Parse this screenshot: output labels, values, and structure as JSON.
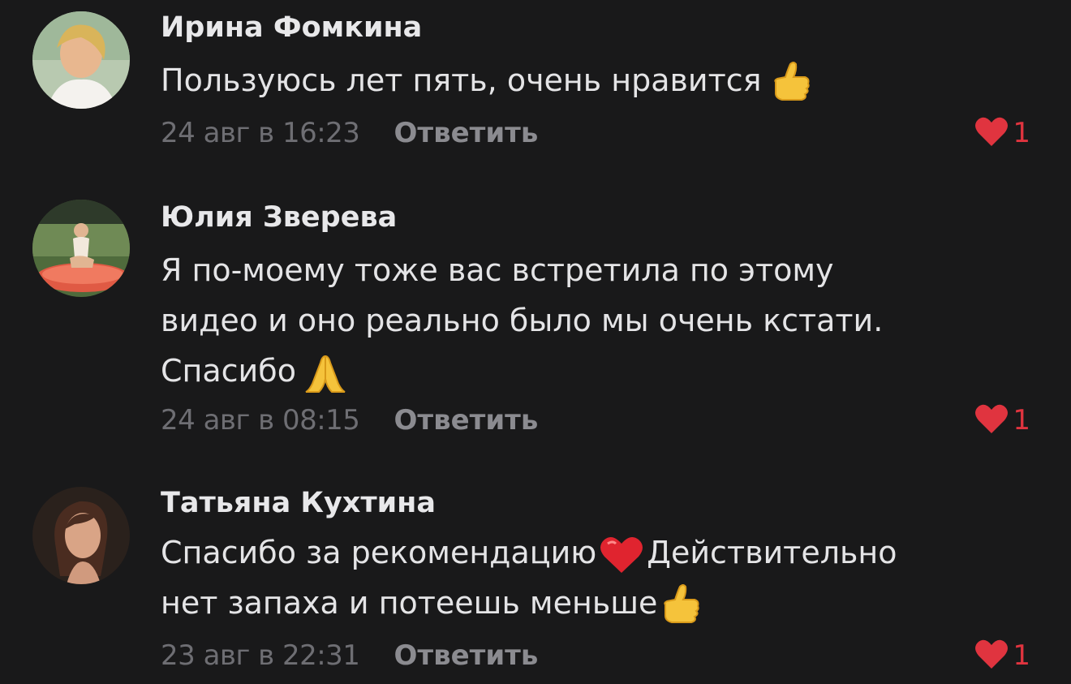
{
  "comments": [
    {
      "author": "Ирина Фомкина",
      "lines": [
        "Пользуюсь лет пять, очень нравится"
      ],
      "date": "24 авг в 16:23",
      "reply_label": "Ответить",
      "likes": "1",
      "emoji": "thumbs-up"
    },
    {
      "author": "Юлия Зверева",
      "lines": [
        "Я по-моему тоже вас встретила по этому",
        "видео и оно реально было мы очень кстати.",
        "Спасибо"
      ],
      "date": "24 авг в 08:15",
      "reply_label": "Ответить",
      "likes": "1",
      "emoji": "folded-hands"
    },
    {
      "author": "Татьяна Кухтина",
      "lines": [
        "Спасибо за рекомендацию",
        "Действительно",
        "нет запаха и потеешь меньше"
      ],
      "date": "23 авг в 22:31",
      "reply_label": "Ответить",
      "likes": "1",
      "emoji": "red-heart, thumbs-up"
    }
  ],
  "colors": {
    "background": "#19191a",
    "like_heart": "#e0343f",
    "text": "#e4e4e6",
    "meta": "#6e6e73"
  }
}
